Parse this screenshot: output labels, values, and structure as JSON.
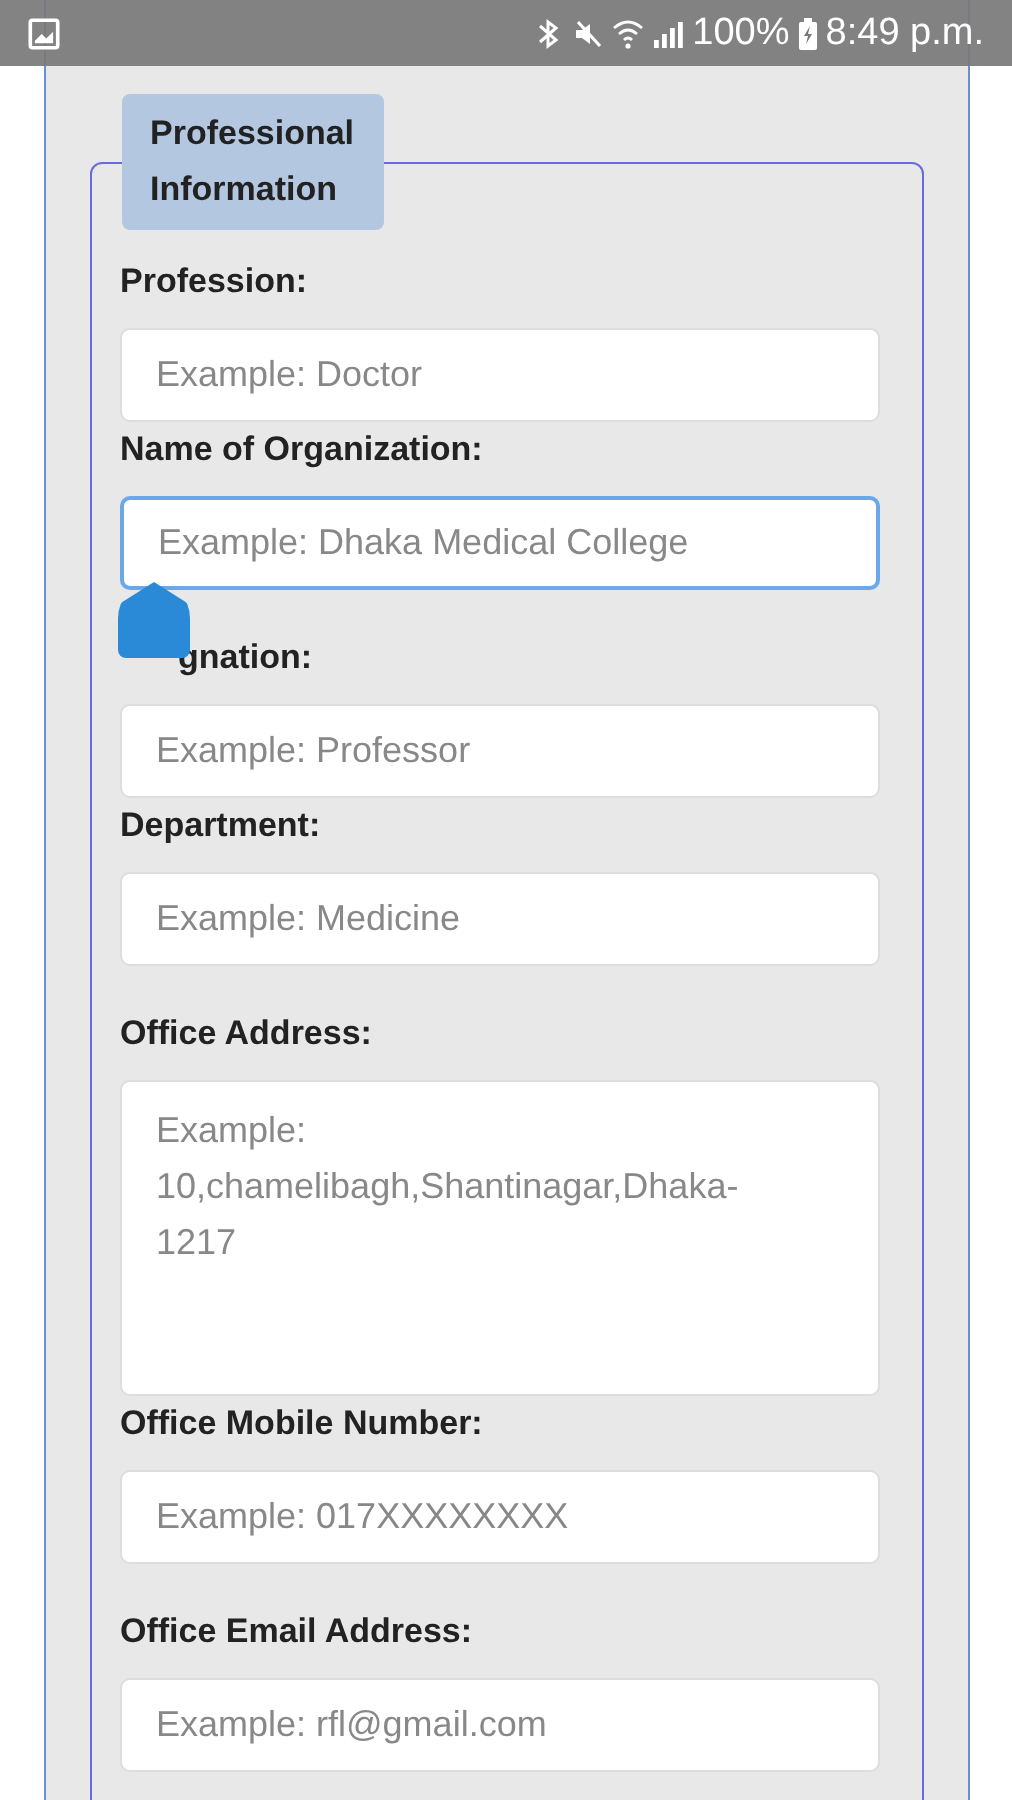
{
  "status_bar": {
    "battery": "100%",
    "time": "8:49 p.m."
  },
  "section": {
    "title": "Professional Information"
  },
  "fields": [
    {
      "kind": "input",
      "label": "Profession:",
      "placeholder": "Example: Doctor",
      "focused": false
    },
    {
      "kind": "input",
      "label": "Name of Organization:",
      "placeholder": "Example: Dhaka Medical College",
      "focused": true
    },
    {
      "kind": "input",
      "label": "gnation:",
      "placeholder": "Example: Professor",
      "focused": false
    },
    {
      "kind": "input",
      "label": "Department:",
      "placeholder": "Example: Medicine",
      "focused": false
    },
    {
      "kind": "textarea",
      "label": "Office Address:",
      "placeholder": "Example: 10,chamelibagh,Shantinagar,Dhaka-1217",
      "focused": false
    },
    {
      "kind": "input",
      "label": "Office Mobile Number:",
      "placeholder": "Example: 017XXXXXXXX",
      "focused": false
    },
    {
      "kind": "input",
      "label": "Office Email Address:",
      "placeholder": "Example: rfl@gmail.com",
      "focused": false
    }
  ]
}
